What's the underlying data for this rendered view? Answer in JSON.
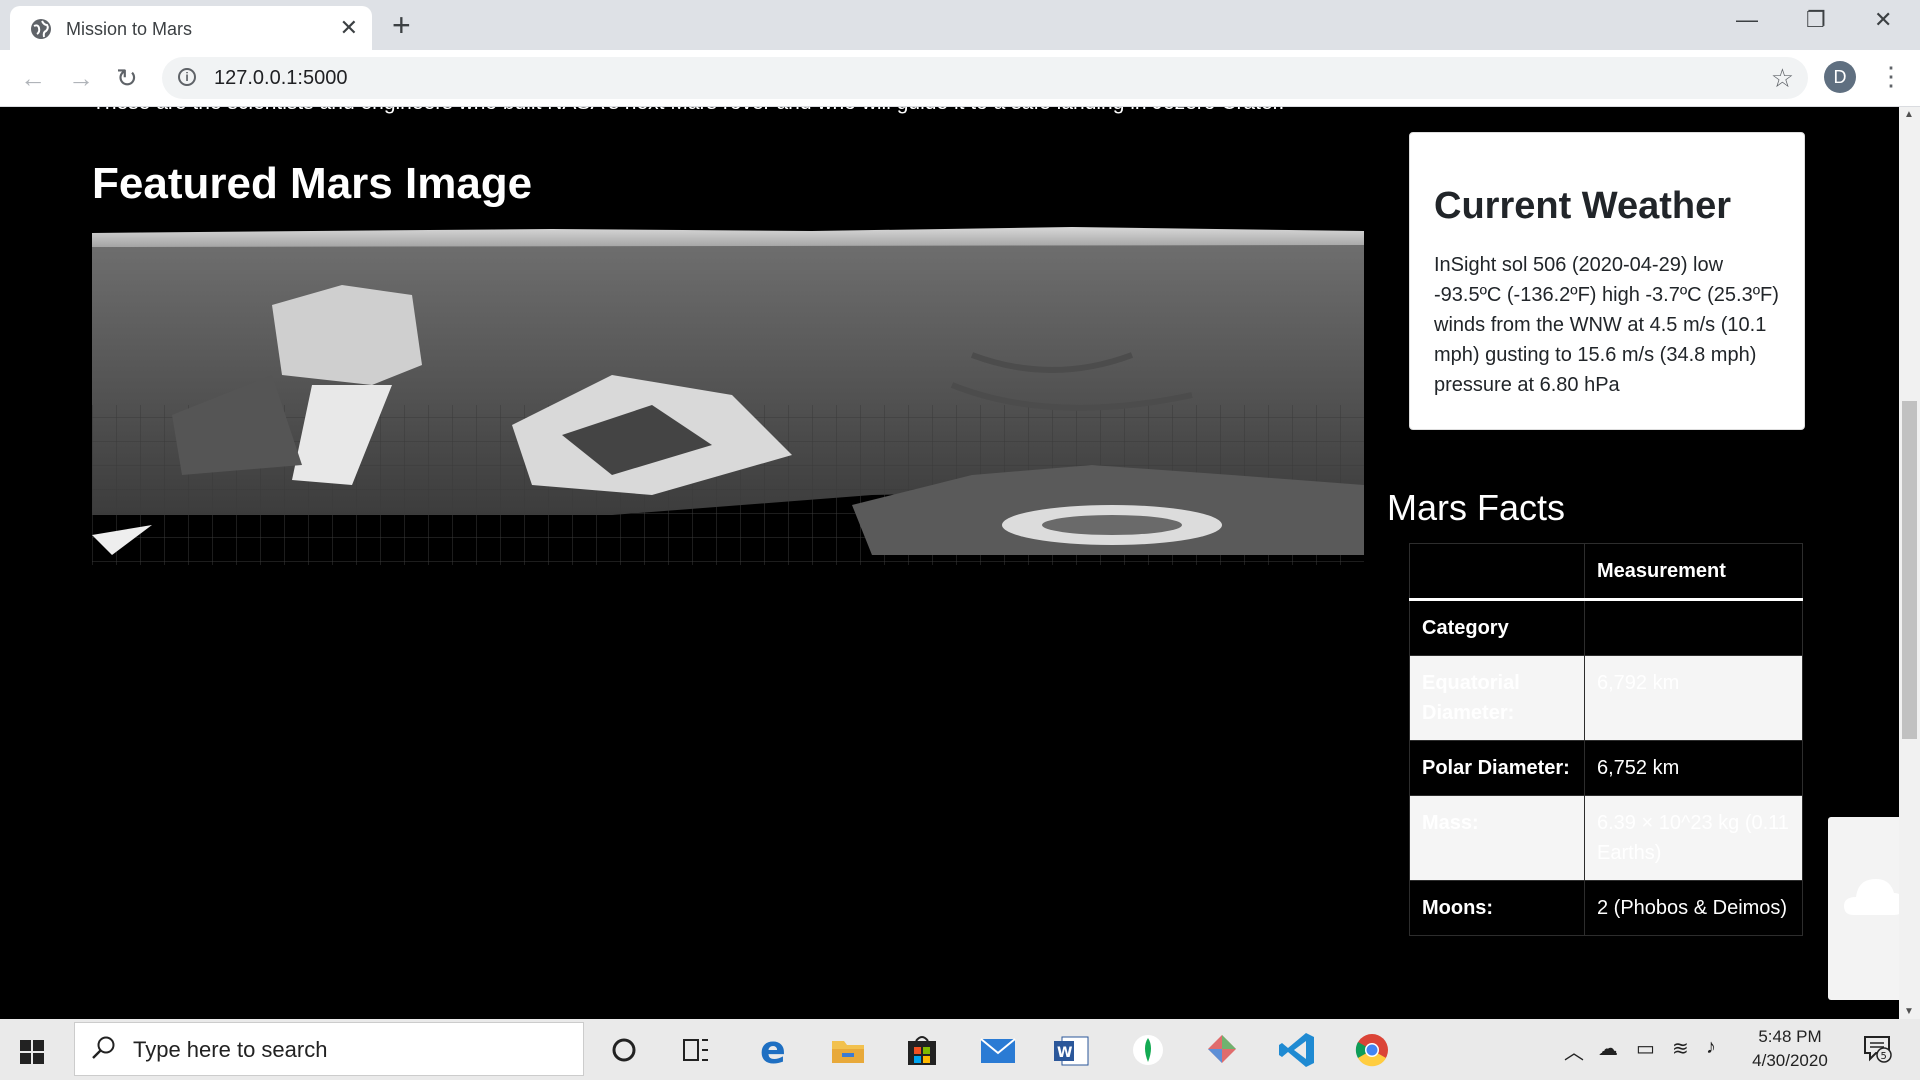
{
  "browser": {
    "tab_title": "Mission to Mars",
    "url": "127.0.0.1:5000",
    "profile_initial": "D",
    "window_controls": {
      "minimize": "—",
      "restore": "❐",
      "close": "✕"
    }
  },
  "page": {
    "intro_text": "These are the scientists and engineers who built NASA's next Mars rover and who will guide it to a safe landing in Jezero Crater.",
    "featured_title": "Featured Mars Image",
    "weather": {
      "title": "Current Weather",
      "text": "InSight sol 506 (2020-04-29) low -93.5ºC (-136.2ºF) high -3.7ºC (25.3ºF) winds from the WNW at 4.5 m/s (10.1 mph) gusting to 15.6 m/s (34.8 mph) pressure at 6.80 hPa"
    },
    "facts": {
      "title": "Mars Facts",
      "header": {
        "col1": "",
        "col2": "Measurement"
      },
      "index_label": "Category",
      "rows": [
        {
          "category": "Equatorial Diameter:",
          "value": "6,792 km"
        },
        {
          "category": "Polar Diameter:",
          "value": "6,752 km"
        },
        {
          "category": "Mass:",
          "value": "6.39 × 10^23 kg (0.11 Earths)"
        },
        {
          "category": "Moons:",
          "value": "2 (Phobos & Deimos)"
        }
      ]
    }
  },
  "taskbar": {
    "search_placeholder": "Type here to search",
    "time": "5:48 PM",
    "date": "4/30/2020",
    "notification_count": "5",
    "apps": [
      "cortana-icon",
      "task-view-icon",
      "edge-icon",
      "file-explorer-icon",
      "store-icon",
      "mail-icon",
      "word-icon",
      "mongodb-icon",
      "app-icon",
      "vscode-icon",
      "chrome-icon"
    ]
  }
}
